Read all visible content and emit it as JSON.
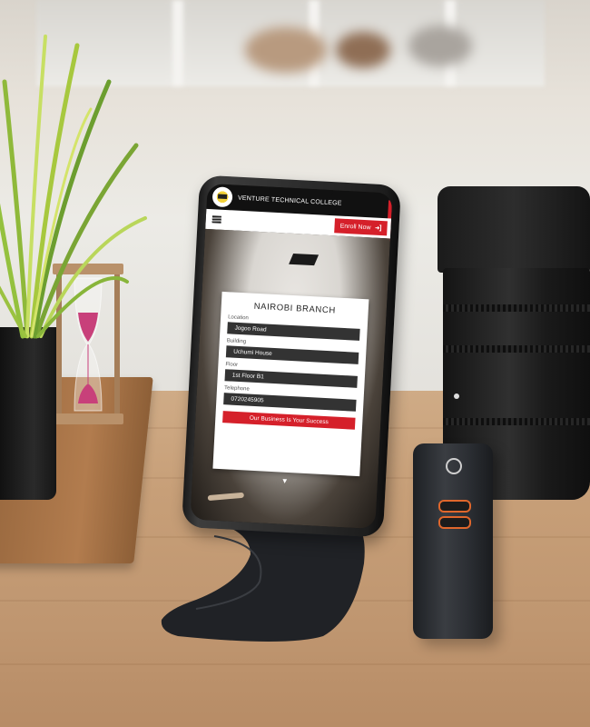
{
  "app": {
    "title": "VENTURE TECHNICAL COLLEGE",
    "enroll_label": "Enroll Now",
    "enroll_icon": "login-arrow-icon",
    "menu_icon": "hamburger-icon"
  },
  "branch_card": {
    "title": "NAIROBI BRANCH",
    "fields": [
      {
        "label": "Location",
        "value": "Jogoo Road"
      },
      {
        "label": "Building",
        "value": "Uchumi House"
      },
      {
        "label": "Floor",
        "value": "1st Floor B1"
      },
      {
        "label": "Telephone",
        "value": "0720245905"
      }
    ],
    "cta_label": "Our Business Is Your Success",
    "scroll_icon": "chevron-down-icon"
  },
  "colors": {
    "brand_red": "#d5202a",
    "header_dark": "#111111",
    "field_dark": "#333333"
  }
}
